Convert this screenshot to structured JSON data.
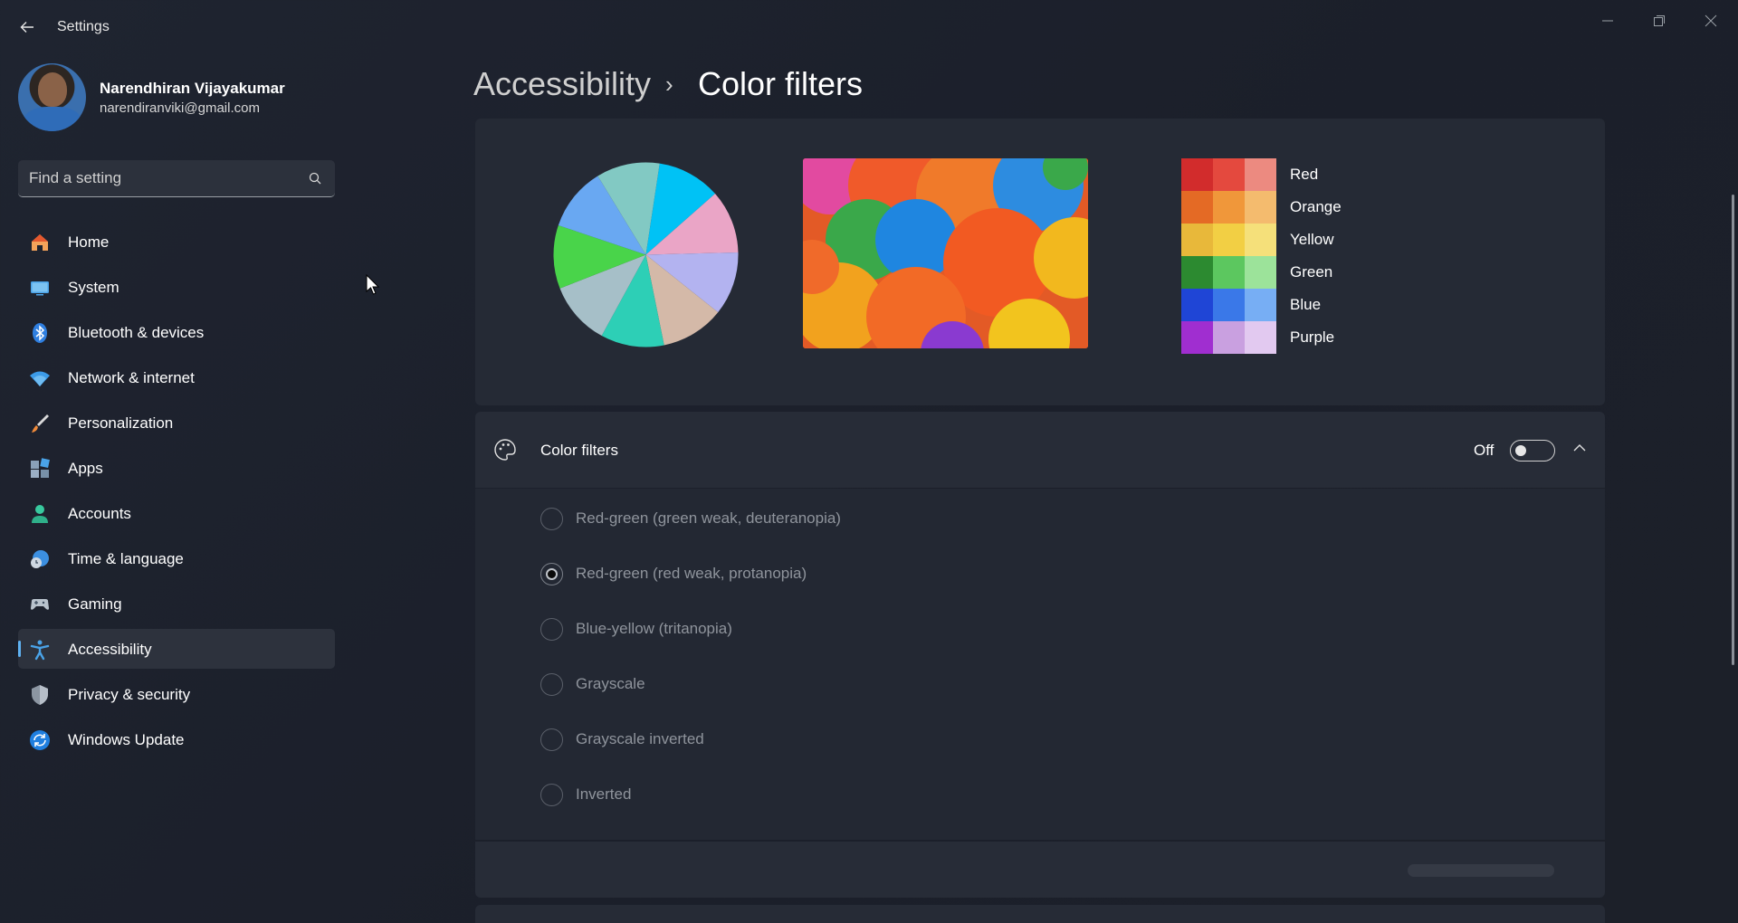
{
  "window": {
    "title": "Settings",
    "controls": {
      "minimize": "minimize-icon",
      "maximize": "restore-icon",
      "close": "close-icon"
    }
  },
  "profile": {
    "name": "Narendhiran Vijayakumar",
    "email": "narendiranviki@gmail.com"
  },
  "search": {
    "placeholder": "Find a setting"
  },
  "nav": {
    "items": [
      {
        "label": "Home",
        "icon": "home-icon"
      },
      {
        "label": "System",
        "icon": "system-icon"
      },
      {
        "label": "Bluetooth & devices",
        "icon": "bluetooth-icon"
      },
      {
        "label": "Network & internet",
        "icon": "wifi-icon"
      },
      {
        "label": "Personalization",
        "icon": "brush-icon"
      },
      {
        "label": "Apps",
        "icon": "apps-icon"
      },
      {
        "label": "Accounts",
        "icon": "person-icon"
      },
      {
        "label": "Time & language",
        "icon": "globe-clock-icon"
      },
      {
        "label": "Gaming",
        "icon": "gamepad-icon"
      },
      {
        "label": "Accessibility",
        "icon": "accessibility-icon",
        "active": true
      },
      {
        "label": "Privacy & security",
        "icon": "shield-icon"
      },
      {
        "label": "Windows Update",
        "icon": "update-icon"
      }
    ]
  },
  "breadcrumb": {
    "parent": "Accessibility",
    "separator": "›",
    "current": "Color filters"
  },
  "preview": {
    "swatches": [
      {
        "label": "Red",
        "colors": [
          "#d22c2c",
          "#e4493e",
          "#ec8a80"
        ]
      },
      {
        "label": "Orange",
        "colors": [
          "#e46a25",
          "#f0973a",
          "#f4bb6e"
        ]
      },
      {
        "label": "Yellow",
        "colors": [
          "#e8b83a",
          "#f2cf44",
          "#f5e07a"
        ]
      },
      {
        "label": "Green",
        "colors": [
          "#2c8a30",
          "#5cc75f",
          "#9ce39a"
        ]
      },
      {
        "label": "Blue",
        "colors": [
          "#1f45d6",
          "#3a78e8",
          "#77aef4"
        ]
      },
      {
        "label": "Purple",
        "colors": [
          "#a02ed0",
          "#c9a0e0",
          "#e2c9f0"
        ]
      }
    ],
    "pie_colors": [
      "#00c2f5",
      "#eaa5c6",
      "#b3b3f0",
      "#d4b9a8",
      "#2dcfb6",
      "#a6bfc8",
      "#49d44a",
      "#69a8f2",
      "#82c9c3"
    ]
  },
  "color_filters": {
    "title": "Color filters",
    "state_label": "Off",
    "enabled": false,
    "expanded": true,
    "options": [
      {
        "label": "Red-green (green weak, deuteranopia)",
        "checked": false
      },
      {
        "label": "Red-green (red weak, protanopia)",
        "checked": true
      },
      {
        "label": "Blue-yellow (tritanopia)",
        "checked": false
      },
      {
        "label": "Grayscale",
        "checked": false
      },
      {
        "label": "Grayscale inverted",
        "checked": false
      },
      {
        "label": "Inverted",
        "checked": false
      }
    ]
  }
}
